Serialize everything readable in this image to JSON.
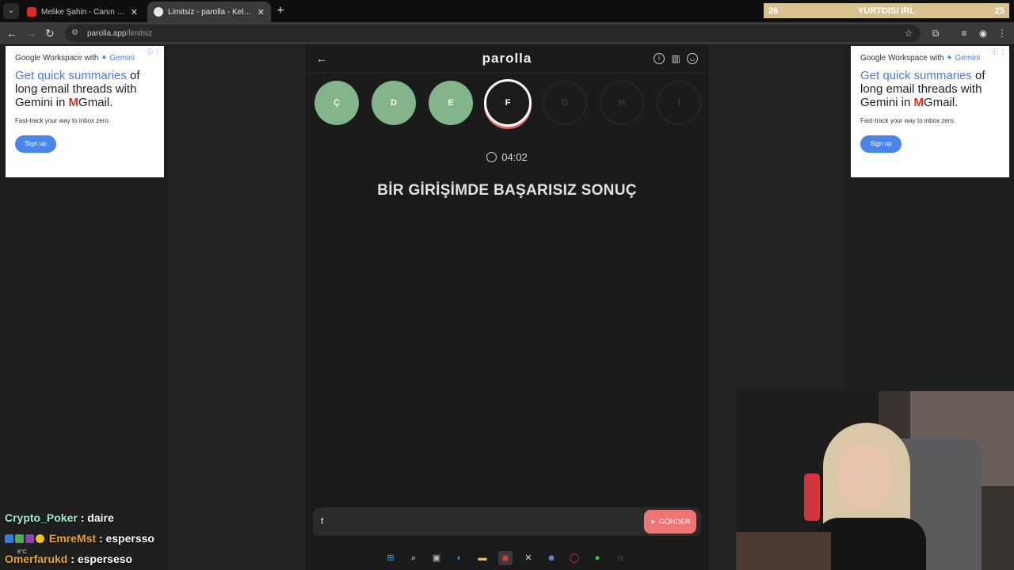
{
  "browser": {
    "tabs": [
      {
        "title": "Melike Şahin - Canın Beni Çekti",
        "favicon": "youtube-icon",
        "color": "#e02a2a"
      },
      {
        "title": "Limitsiz - parolla - Kelime oyunu",
        "favicon": "parolla-icon",
        "color": "#e8e8e8"
      }
    ],
    "url_domain": "parolla.app",
    "url_path": "/limitsiz"
  },
  "stream_overlay": {
    "left_number": "26",
    "label": "YURTDISI IRL",
    "right_number": "25"
  },
  "ad": {
    "header_prefix": "Google Workspace with",
    "header_brand": "✦ Gemini",
    "headline_highlight": "Get quick summaries",
    "headline_rest_1": " of long email threads with Gemini in ",
    "headline_gmail": "M",
    "headline_rest_2": "Gmail.",
    "subtext": "Fast-track your way to inbox zero.",
    "cta": "Sign up"
  },
  "game": {
    "logo": "parolla",
    "letters": [
      {
        "char": "Ç",
        "state": "done"
      },
      {
        "char": "D",
        "state": "done"
      },
      {
        "char": "E",
        "state": "done"
      },
      {
        "char": "F",
        "state": "current"
      },
      {
        "char": "G",
        "state": "future"
      },
      {
        "char": "H",
        "state": "future"
      },
      {
        "char": "İ",
        "state": "future"
      }
    ],
    "timer": "04:02",
    "headline": "BİR GİRİŞİMDE BAŞARISIZ SONUÇ",
    "input_value": "f",
    "send_label": "GÖNDER"
  },
  "chat": [
    {
      "user": "Crypto_Poker",
      "message": "daire"
    },
    {
      "user": "EmreMst",
      "message": "espersso"
    },
    {
      "user": "Omerfarukd",
      "message": "esperseso"
    }
  ],
  "weather": "8°C",
  "colors": {
    "done_letter": "#84b58a",
    "send_button": "#ef7474",
    "current_ring": "#e36a6a"
  }
}
